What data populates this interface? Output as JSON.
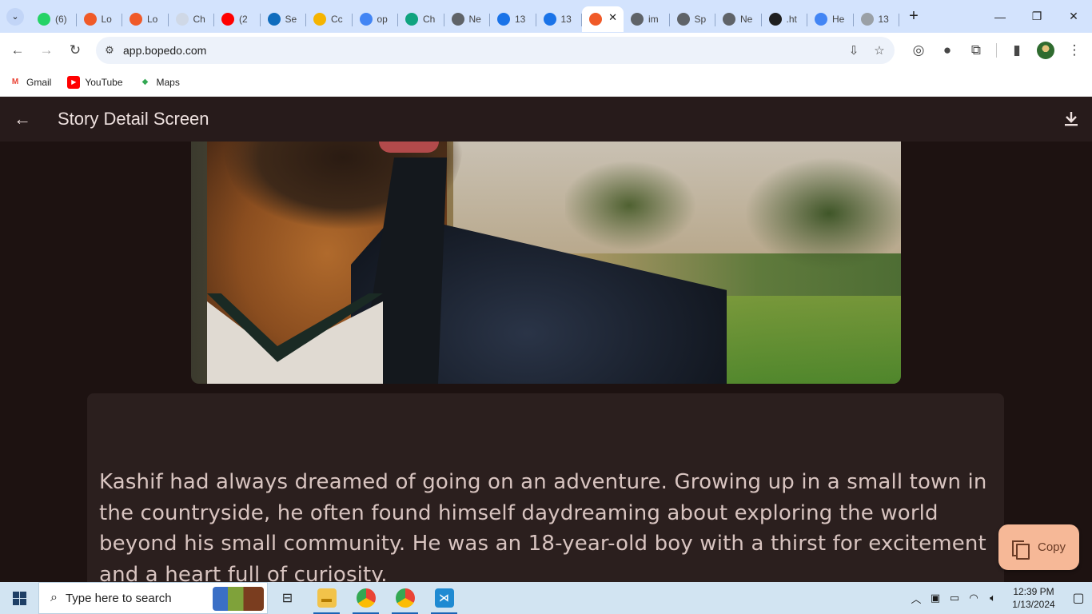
{
  "browser": {
    "tabs": [
      {
        "label": "(6)",
        "favicon": "whatsapp-icon",
        "color": "#25d366"
      },
      {
        "label": "Lo",
        "favicon": "bopedo-icon",
        "color": "#f05a28"
      },
      {
        "label": "Lo",
        "favicon": "bopedo-icon",
        "color": "#f05a28"
      },
      {
        "label": "Ch",
        "favicon": "blank-page-icon",
        "color": "#cfd8e6"
      },
      {
        "label": "(2",
        "favicon": "youtube-icon",
        "color": "#ff0000"
      },
      {
        "label": "Se",
        "favicon": "edge-icon",
        "color": "#0f6cbd"
      },
      {
        "label": "Cc",
        "favicon": "hand-icon",
        "color": "#f5b400"
      },
      {
        "label": "op",
        "favicon": "google-icon",
        "color": "#4285f4"
      },
      {
        "label": "Ch",
        "favicon": "chatgpt-icon",
        "color": "#10a37f"
      },
      {
        "label": "Ne",
        "favicon": "globe-icon",
        "color": "#5f6368"
      },
      {
        "label": "13",
        "favicon": "blue-dot-icon",
        "color": "#1a73e8"
      },
      {
        "label": "13",
        "favicon": "blue-dot-icon",
        "color": "#1a73e8"
      },
      {
        "label": "",
        "favicon": "bopedo-icon",
        "color": "#f05a28",
        "active": true
      },
      {
        "label": "im",
        "favicon": "globe-icon",
        "color": "#5f6368"
      },
      {
        "label": "Sp",
        "favicon": "globe-icon",
        "color": "#5f6368"
      },
      {
        "label": "Ne",
        "favicon": "globe-icon",
        "color": "#5f6368"
      },
      {
        "label": ".ht",
        "favicon": "github-icon",
        "color": "#1f1f1f"
      },
      {
        "label": "He",
        "favicon": "google-icon",
        "color": "#4285f4"
      },
      {
        "label": "13",
        "favicon": "globe-icon",
        "color": "#9aa0a6"
      }
    ],
    "url": "app.bopedo.com",
    "bookmarks": [
      {
        "label": "Gmail",
        "icon": "gmail-icon"
      },
      {
        "label": "YouTube",
        "icon": "youtube-icon"
      },
      {
        "label": "Maps",
        "icon": "maps-icon"
      }
    ]
  },
  "app": {
    "title": "Story Detail Screen",
    "story_text": "Kashif had always dreamed of going on an adventure. Growing up in a small town in the countryside, he often found himself daydreaming about exploring the world beyond his small community. He was an 18-year-old boy with a thirst for excitement and a heart full of curiosity.",
    "copy_label": "Copy",
    "colors": {
      "appbar": "#271b1b",
      "background": "#1d1211",
      "card": "#2b1f1e",
      "copy_button": "#f6b897"
    }
  },
  "taskbar": {
    "search_placeholder": "Type here to search",
    "time": "12:39 PM",
    "date": "1/13/2024"
  }
}
